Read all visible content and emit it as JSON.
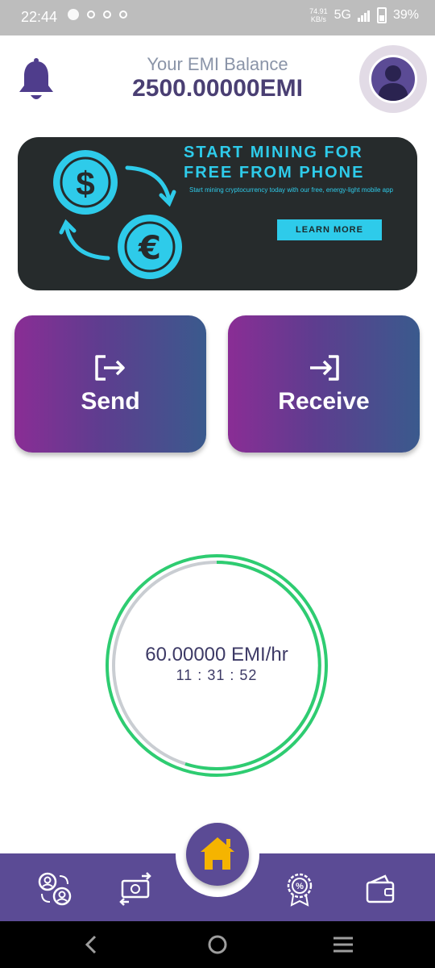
{
  "status_bar": {
    "time": "22:44",
    "network": "5G",
    "speed_top": "74.91",
    "speed_bottom": "KB/s",
    "battery": "39%"
  },
  "header": {
    "balance_title": "Your EMI Balance",
    "balance_value": "2500.00000EMI",
    "icons": [
      "bell-icon",
      "user-icon"
    ]
  },
  "banner": {
    "title_line1": "START MINING FOR",
    "title_line2": "FREE FROM PHONE",
    "subtitle": "Start mining cryptocurrency today with our free, energy-light mobile app",
    "button": "LEARN MORE",
    "accent": "#2ecbea",
    "background": "#262b2c"
  },
  "actions": {
    "send_label": "Send",
    "receive_label": "Receive"
  },
  "mining": {
    "rate": "60.00000 EMI/hr",
    "timer": "11 : 31 : 52",
    "ring_color": "#2ecc71"
  },
  "bottom_nav": {
    "items": [
      "referral-icon",
      "exchange-icon",
      "home-icon",
      "discount-badge-icon",
      "wallet-icon"
    ],
    "active": "home-icon",
    "background": "#5b4b95",
    "home_accent": "#f5b400"
  }
}
